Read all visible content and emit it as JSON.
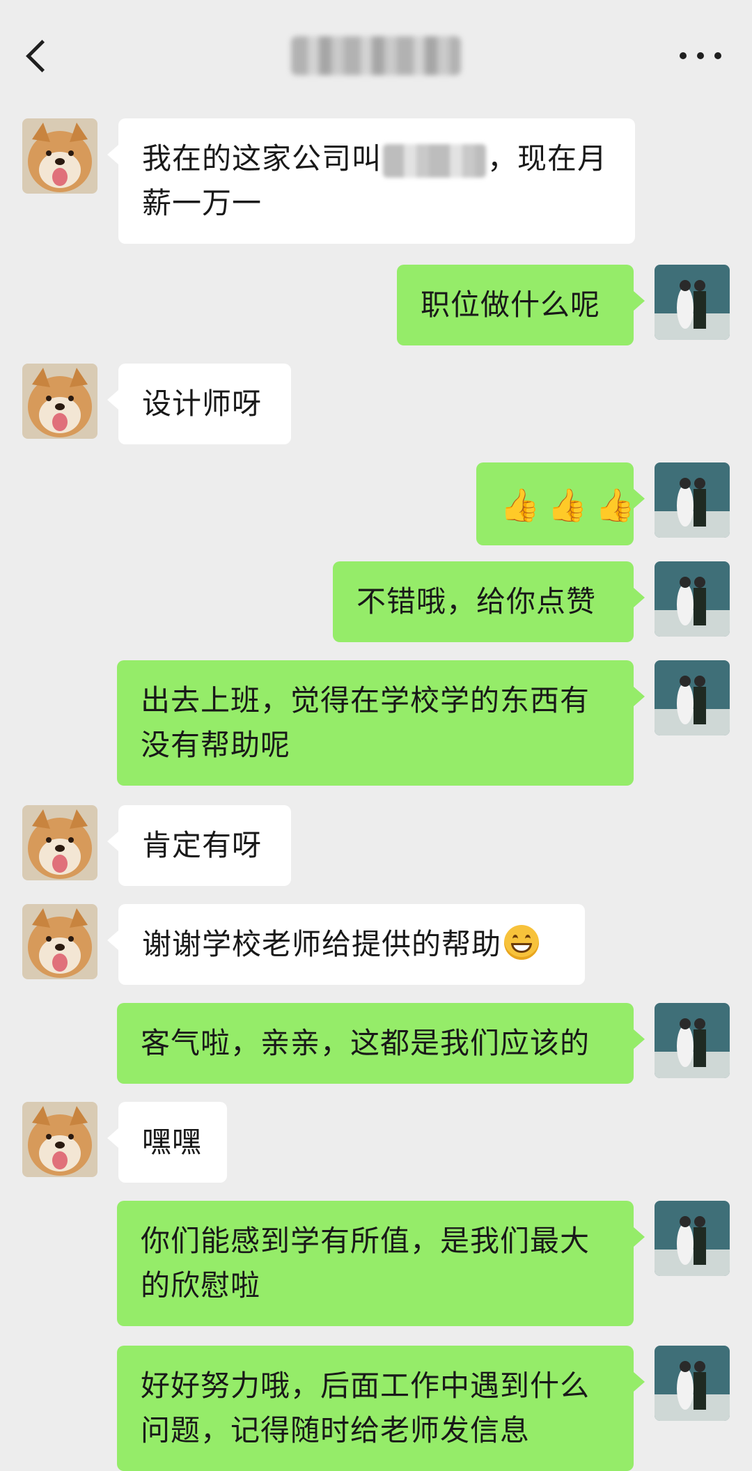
{
  "header": {
    "title": "",
    "back_icon": "chevron-left-icon",
    "more_icon": "more-dots-icon"
  },
  "messages": [
    {
      "side": "in",
      "text_before": "我在的这家公司叫",
      "redacted": true,
      "text_after": "，现在月薪一万一"
    },
    {
      "side": "out",
      "text": "职位做什么呢"
    },
    {
      "side": "in",
      "text": "设计师呀"
    },
    {
      "side": "out",
      "emoji": "👍👍👍"
    },
    {
      "side": "out",
      "text": "不错哦，给你点赞"
    },
    {
      "side": "out",
      "text": "出去上班，觉得在学校学的东西有没有帮助呢"
    },
    {
      "side": "in",
      "text": "肯定有呀"
    },
    {
      "side": "in",
      "text": "谢谢学校老师给提供的帮助",
      "emoji": "grin-emoji"
    },
    {
      "side": "out",
      "text": "客气啦，亲亲，这都是我们应该的"
    },
    {
      "side": "in",
      "text": "嘿嘿"
    },
    {
      "side": "out",
      "text": "你们能感到学有所值，是我们最大的欣慰啦"
    },
    {
      "side": "out",
      "text": "好好努力哦，后面工作中遇到什么问题，记得随时给老师发信息"
    }
  ],
  "colors": {
    "background": "#ededed",
    "incoming_bubble": "#ffffff",
    "outgoing_bubble": "#95ec69",
    "text": "#191919"
  }
}
